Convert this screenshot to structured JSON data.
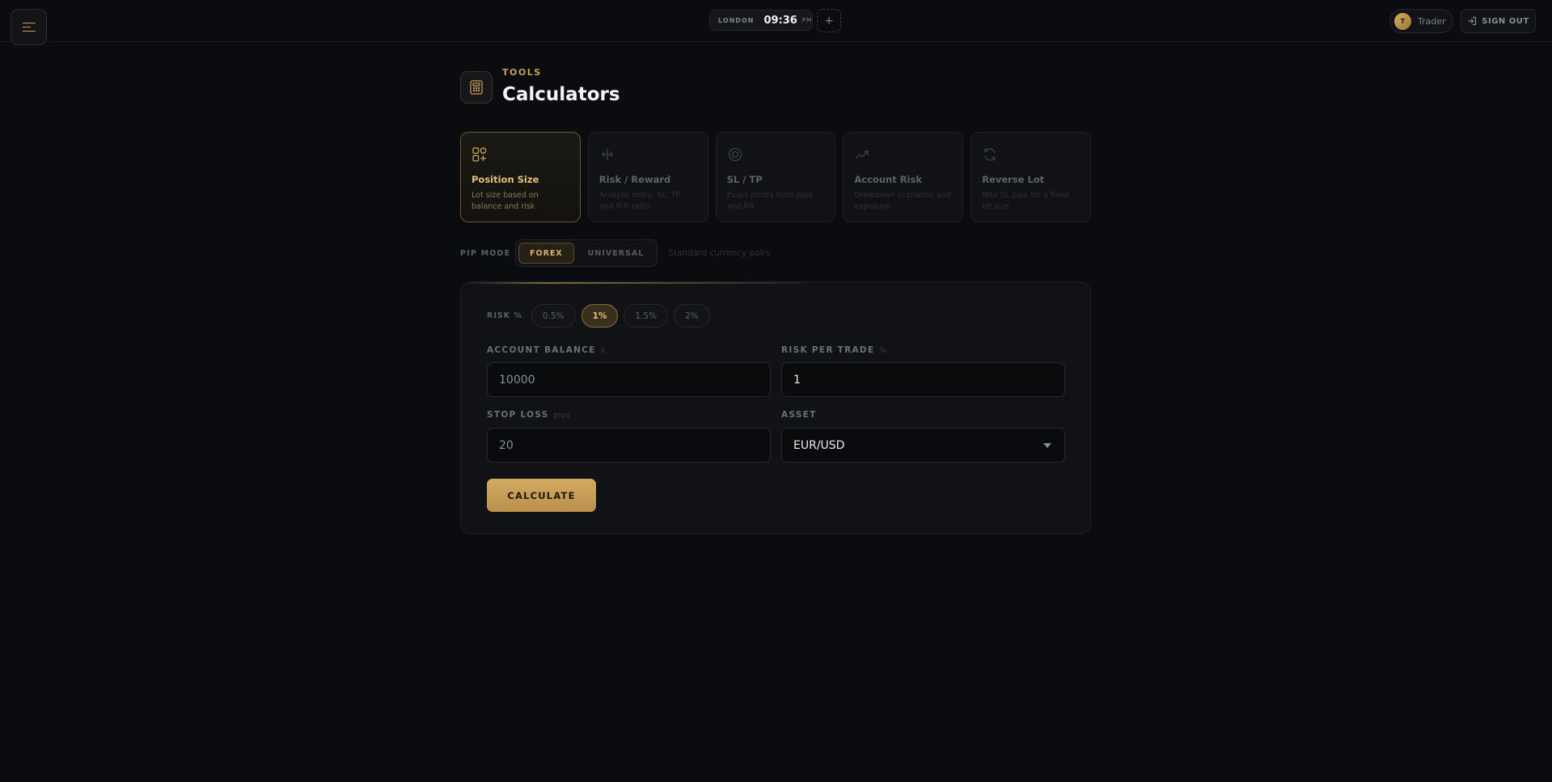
{
  "topbar": {
    "clock": {
      "city": "LONDON",
      "time": "09:36",
      "ampm": "PM"
    },
    "add_clock": "+",
    "user": {
      "initial": "T",
      "name": "Trader"
    },
    "signout_label": "SIGN OUT"
  },
  "header": {
    "eyebrow": "TOOLS",
    "title": "Calculators"
  },
  "tools": [
    {
      "name": "Position Size",
      "desc": "Lot size based on balance and risk",
      "icon": "position-size-icon",
      "active": true
    },
    {
      "name": "Risk / Reward",
      "desc": "Analyze entry, SL, TP and R:R ratio",
      "icon": "risk-reward-icon",
      "active": false
    },
    {
      "name": "SL / TP",
      "desc": "Exact prices from pips and RR",
      "icon": "target-icon",
      "active": false
    },
    {
      "name": "Account Risk",
      "desc": "Drawdown scenarios and exposure",
      "icon": "trend-icon",
      "active": false
    },
    {
      "name": "Reverse Lot",
      "desc": "Max SL pips for a fixed lot size",
      "icon": "refresh-icon",
      "active": false
    }
  ],
  "pip_mode": {
    "label": "PIP MODE",
    "options": [
      "FOREX",
      "UNIVERSAL"
    ],
    "selected": "FOREX",
    "hint": "Standard currency pairs"
  },
  "risk_presets": {
    "label": "RISK %",
    "options": [
      "0.5%",
      "1%",
      "1.5%",
      "2%"
    ],
    "selected": "1%"
  },
  "form": {
    "account_balance": {
      "label": "ACCOUNT BALANCE",
      "unit": "$",
      "value": "10000"
    },
    "risk_per_trade": {
      "label": "RISK PER TRADE",
      "unit": "%",
      "value": "1"
    },
    "stop_loss": {
      "label": "STOP LOSS",
      "unit": "pips",
      "value": "20"
    },
    "asset": {
      "label": "ASSET",
      "value": "EUR/USD"
    },
    "calculate_label": "CALCULATE"
  },
  "colors": {
    "accent": "#c9a15b",
    "background": "#0a0c0f",
    "panel": "#101215"
  }
}
